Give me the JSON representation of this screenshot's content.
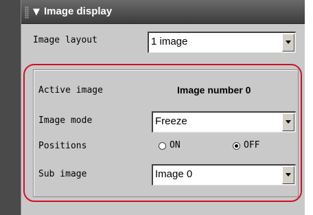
{
  "section": {
    "title": "Image display"
  },
  "image_layout": {
    "label": "Image layout",
    "value": "1 image"
  },
  "active_image": {
    "label": "Active image",
    "value": "Image number 0"
  },
  "image_mode": {
    "label": "Image mode",
    "value": "Freeze"
  },
  "positions": {
    "label": "Positions",
    "options": [
      "ON",
      "OFF"
    ],
    "selected": "OFF"
  },
  "sub_image": {
    "label": "Sub image",
    "value": "Image 0"
  },
  "colors": {
    "highlight": "#d01020",
    "header": "#3c3c3c",
    "panel": "#c9c9c9"
  }
}
